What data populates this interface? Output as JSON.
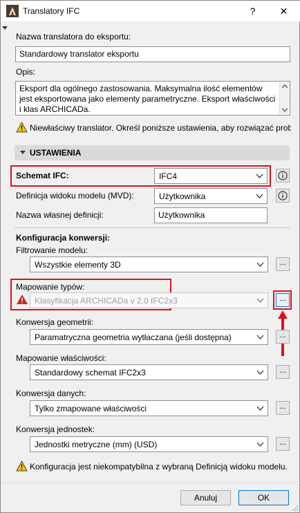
{
  "window": {
    "title": "Translatory IFC",
    "help_label": "?",
    "close_label": "✕"
  },
  "export_name": {
    "label": "Nazwa translatora do eksportu:",
    "value": "Standardowy translator eksportu"
  },
  "description": {
    "label": "Opis:",
    "value": "Eksport dla ogólnego zastosowania. Maksymalna ilość elementów jest eksportowana jako elementy parametryczne. Eksport właściwości i klas ARCHICADa."
  },
  "warning_top": "Niewłaściwy translator. Określ poniższe ustawienia, aby rozwiązać problem",
  "settings": {
    "header": "USTAWIENIA",
    "schema_label": "Schemat IFC:",
    "schema_value": "IFC4",
    "mvd_label": "Definicja widoku modelu (MVD):",
    "mvd_value": "Użytkownika",
    "custom_name_label": "Nazwa własnej definicji:",
    "custom_name_value": "Użytkownika"
  },
  "conversion": {
    "header": "Konfiguracja konwersji:",
    "filter_label": "Filtrowanie modelu:",
    "filter_value": "Wszystkie elementy 3D",
    "type_mapping_label": "Mapowanie typów:",
    "type_mapping_value": "Klasyfikacja ARCHICADa v 2.0 IFC2x3",
    "geometry_label": "Konwersja geometrii:",
    "geometry_value": "Paramatryczna geometria wytłaczana (jeśli dostępna)",
    "property_mapping_label": "Mapowanie właściwości:",
    "property_mapping_value": "Standardowy schemat IFC2x3",
    "data_label": "Konwersja danych:",
    "data_value": "Tylko zmapowane właściwości",
    "units_label": "Konwersja jednostek:",
    "units_value": "Jednostki metryczne (mm) (USD)",
    "browse_label": "..."
  },
  "warning_bottom": "Konfiguracja jest niekompatybilna z wybraną Definicją widoku modelu.",
  "buttons": {
    "cancel": "Anuluj",
    "ok": "OK"
  },
  "colors": {
    "highlight_red": "#e0101e",
    "warning_yellow": "#f7c600",
    "error_red": "#c62828",
    "focus_blue": "#0078d7"
  }
}
